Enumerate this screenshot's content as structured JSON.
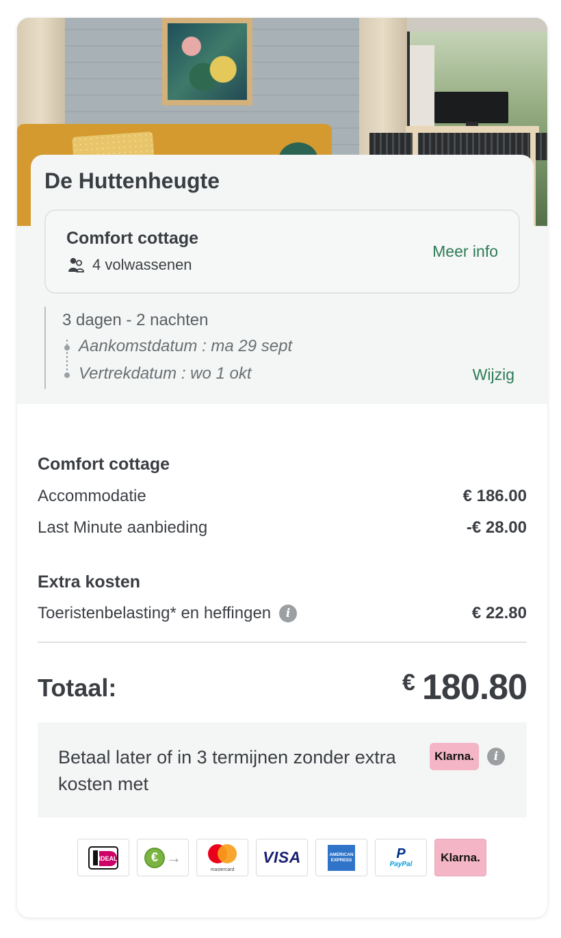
{
  "property": {
    "name": "De Huttenheugte"
  },
  "unit": {
    "title": "Comfort cottage",
    "guests": "4 volwassenen",
    "more_info_label": "Meer info"
  },
  "stay": {
    "duration": "3 dagen - 2 nachten",
    "arrival": "Aankomstdatum : ma 29 sept",
    "departure": "Vertrekdatum : wo 1 okt",
    "change_label": "Wijzig"
  },
  "pricing": {
    "section_accommodation": "Comfort cottage",
    "lines": [
      {
        "label": "Accommodatie",
        "amount": "€ 186.00"
      },
      {
        "label": "Last Minute aanbieding",
        "amount": "-€ 28.00"
      }
    ],
    "section_extra": "Extra kosten",
    "extra_lines": [
      {
        "label": "Toeristenbelasting* en heffingen",
        "amount": "€ 22.80"
      }
    ],
    "total_label": "Totaal:",
    "total_currency": "€",
    "total_amount": "180.80"
  },
  "klarna": {
    "text": "Betaal later of in 3 termijnen zonder extra kosten met",
    "badge": "Klarna."
  },
  "payment_methods": {
    "ideal": "iDEAL",
    "mastercard": "mastercard",
    "visa": "VISA",
    "amex": "AMERICAN EXPRESS",
    "paypal_p": "P",
    "paypal": "PayPal",
    "klarna": "Klarna."
  },
  "icons": {
    "guests": "people-icon",
    "info": "info-icon",
    "ideal": "ideal-logo",
    "bank_transfer": "euro-transfer-icon",
    "mastercard": "mastercard-logo",
    "visa": "visa-logo",
    "amex": "amex-logo",
    "paypal": "paypal-logo",
    "klarna": "klarna-logo"
  },
  "colors": {
    "accent_green": "#2e7a57",
    "panel_bg": "#f3f6f5",
    "klarna_pink": "#f4b6c7"
  }
}
